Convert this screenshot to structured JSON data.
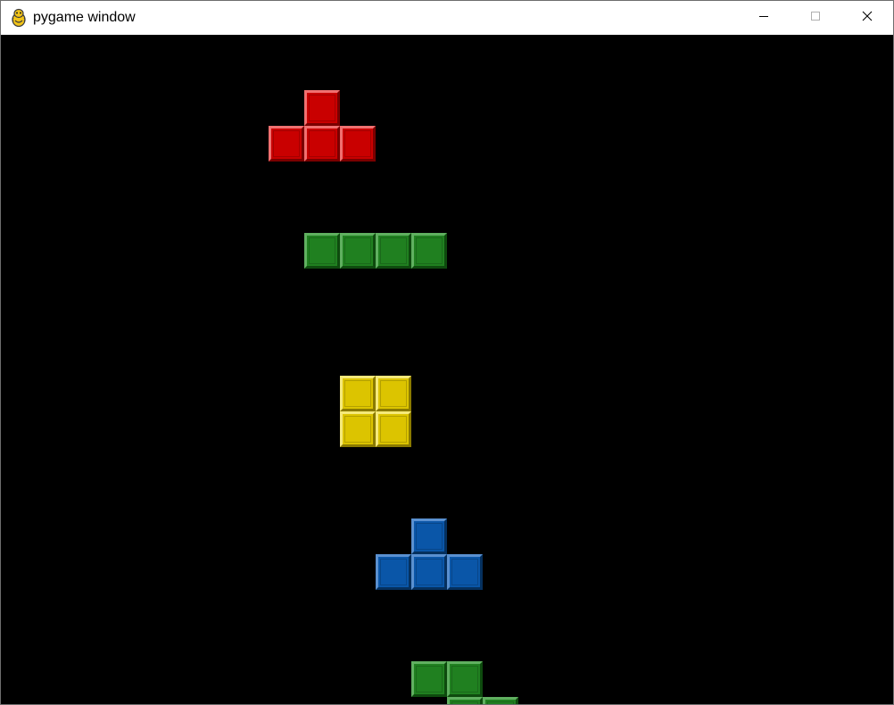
{
  "window": {
    "title": "pygame window",
    "icon": "pygame-snake-icon",
    "controls": {
      "minimize_icon": "minimize-icon",
      "maximize_icon": "maximize-icon",
      "close_icon": "close-icon"
    }
  },
  "game": {
    "background_color": "#000000",
    "pieces": [
      {
        "name": "t-piece-red",
        "shape": "T",
        "color": "red",
        "fill": "#c90000",
        "light": "#f07070",
        "dark": "#7a0000"
      },
      {
        "name": "i-piece-green",
        "shape": "I",
        "color": "green",
        "fill": "#208020",
        "light": "#60b060",
        "dark": "#0e4a0e"
      },
      {
        "name": "o-piece-yellow",
        "shape": "O",
        "color": "yellow",
        "fill": "#dcc400",
        "light": "#f5e97a",
        "dark": "#8a7a00"
      },
      {
        "name": "t-piece-blue",
        "shape": "T",
        "color": "blue",
        "fill": "#0a56a8",
        "light": "#5a90d0",
        "dark": "#05305e"
      },
      {
        "name": "z-piece-green",
        "shape": "Z",
        "color": "green",
        "fill": "#208020",
        "light": "#60b060",
        "dark": "#0e4a0e"
      }
    ]
  }
}
